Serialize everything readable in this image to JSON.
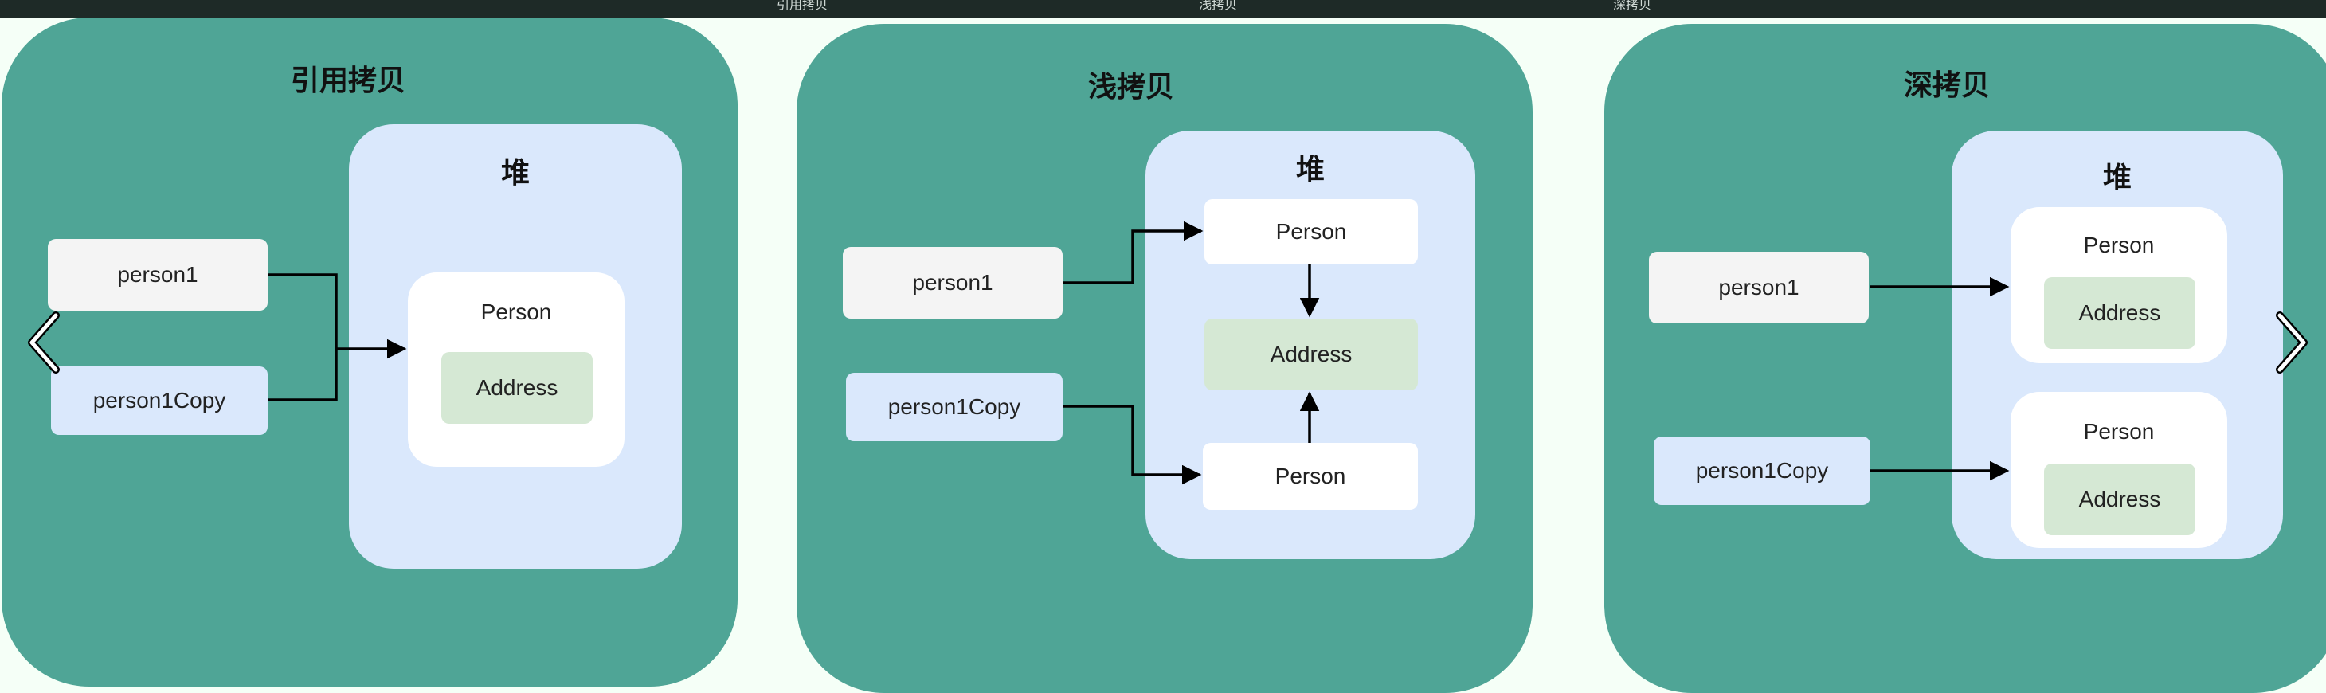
{
  "top_tabs": [
    "引用拷贝",
    "浅拷贝",
    "深拷贝"
  ],
  "panels": [
    {
      "title": "引用拷贝",
      "heap_label": "堆",
      "var1": "person1",
      "var2": "person1Copy",
      "object_label": "Person",
      "address_label": "Address"
    },
    {
      "title": "浅拷贝",
      "heap_label": "堆",
      "var1": "person1",
      "var2": "person1Copy",
      "object_top": "Person",
      "address_label": "Address",
      "object_bottom": "Person"
    },
    {
      "title": "深拷贝",
      "heap_label": "堆",
      "var1": "person1",
      "var2": "person1Copy",
      "object1_label": "Person",
      "address1_label": "Address",
      "object2_label": "Person",
      "address2_label": "Address"
    }
  ],
  "colors": {
    "panel": "#4fa596",
    "heap": "#dae8fc",
    "var_gray": "#f4f4f4",
    "var_blue": "#dae8fc",
    "address": "#d5e8d4",
    "background": "#f5fff7"
  },
  "nav": {
    "prev_icon": "chevron-left-icon",
    "next_icon": "chevron-right-icon"
  }
}
